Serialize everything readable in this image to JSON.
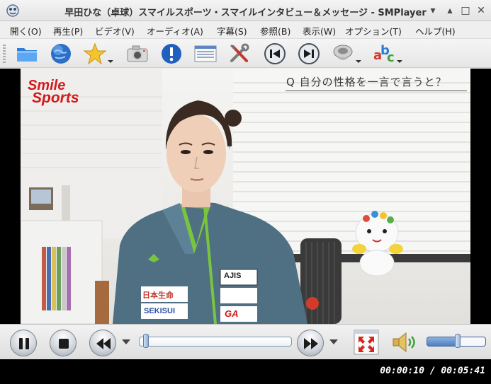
{
  "window": {
    "title": "早田ひな（卓球）スマイルスポーツ・スマイルインタビュー＆メッセージ - SMPlayer",
    "minimize_glyph": "▾",
    "maximize_glyph": "▴",
    "restore_glyph": "□",
    "close_glyph": "✕"
  },
  "menu": {
    "items": [
      {
        "label": "開く(O)"
      },
      {
        "label": "再生(P)"
      },
      {
        "label": "ビデオ(V)"
      },
      {
        "label": "オーディオ(A)"
      },
      {
        "label": "字幕(S)"
      },
      {
        "label": "参照(B)"
      },
      {
        "label": "表示(W)"
      },
      {
        "label": "オプション(T)"
      },
      {
        "label": "ヘルプ(H)"
      }
    ]
  },
  "toolbar": {
    "buttons": [
      {
        "icon": "folder-icon"
      },
      {
        "icon": "globe-icon"
      },
      {
        "icon": "favorites-star-icon"
      },
      {
        "icon": "screenshot-camera-icon"
      },
      {
        "icon": "info-icon"
      },
      {
        "icon": "playlist-icon"
      },
      {
        "icon": "preferences-tools-icon"
      },
      {
        "icon": "previous-icon"
      },
      {
        "icon": "next-icon"
      },
      {
        "icon": "audio-track-icon"
      },
      {
        "icon": "subtitle-abc-icon"
      }
    ]
  },
  "video": {
    "logo_line1": "Smile",
    "logo_line2": "Sports",
    "question": "Q 自分の性格を一言で言うと？",
    "jacket_text_1": "AJIS",
    "jacket_text_2": "日本生命",
    "jacket_text_3": "SEKISUI",
    "jacket_text_4": "GA"
  },
  "controls": {
    "seek_position": 0.029,
    "volume_level": 0.52
  },
  "status": {
    "time": "00:00:10 / 00:05:41"
  },
  "colors": {
    "logo_red": "#d21a1a",
    "jacket_teal": "#4f6f82",
    "jacket_green": "#7ac53f",
    "seek_border": "#7b96b8",
    "volume_fill": "#4f7fc0"
  }
}
